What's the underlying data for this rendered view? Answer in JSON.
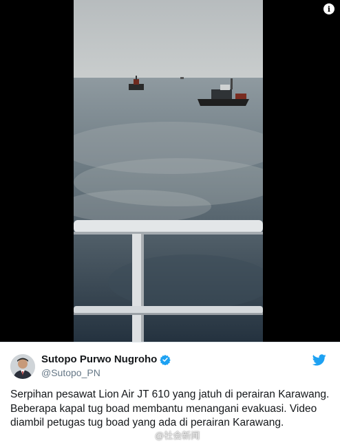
{
  "media": {
    "info_icon": "info-icon",
    "info_glyph": "i"
  },
  "author": {
    "name": "Sutopo Purwo Nugroho",
    "handle": "@Sutopo_PN",
    "verified": true,
    "avatar": "avatar"
  },
  "tweet": {
    "text": "Serpihan pesawat Lion Air JT 610 yang jatuh di perairan Karawang. Beberapa kapal tug boad membantu  menangani evakuasi. Video diambil petugas tug boad yang ada di perairan Karawang."
  },
  "watermark": {
    "text": "@社会新闻"
  },
  "icons": {
    "verified": "verified-badge-icon",
    "twitter": "twitter-bird-icon",
    "weibo": "weibo-logo-icon"
  },
  "colors": {
    "twitter_blue": "#1da1f2",
    "text": "#14171a",
    "secondary": "#657786"
  }
}
